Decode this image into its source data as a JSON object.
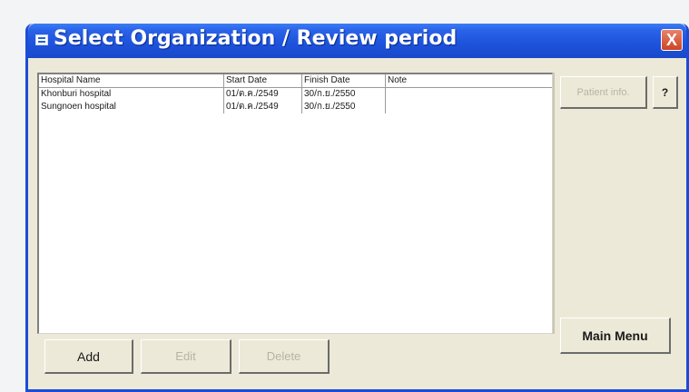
{
  "window": {
    "title": "Select Organization / Review period",
    "close_label": "X"
  },
  "table": {
    "columns": [
      "Hospital Name",
      "Start Date",
      "Finish Date",
      "Note"
    ],
    "rows": [
      [
        "Khonburi hospital",
        "01/ต.ค./2549",
        "30/ก.ย./2550",
        ""
      ],
      [
        "Sungnoen hospital",
        "01/ต.ค./2549",
        "30/ก.ย./2550",
        ""
      ]
    ]
  },
  "buttons": {
    "patient_info": "Patient info.",
    "help": "?",
    "main_menu": "Main Menu",
    "add": "Add",
    "edit": "Edit",
    "delete": "Delete"
  },
  "colors": {
    "titlebar": "#1d52dc",
    "close": "#cc4624",
    "face": "#ece9d8",
    "watermark": "#f2c8cc"
  }
}
